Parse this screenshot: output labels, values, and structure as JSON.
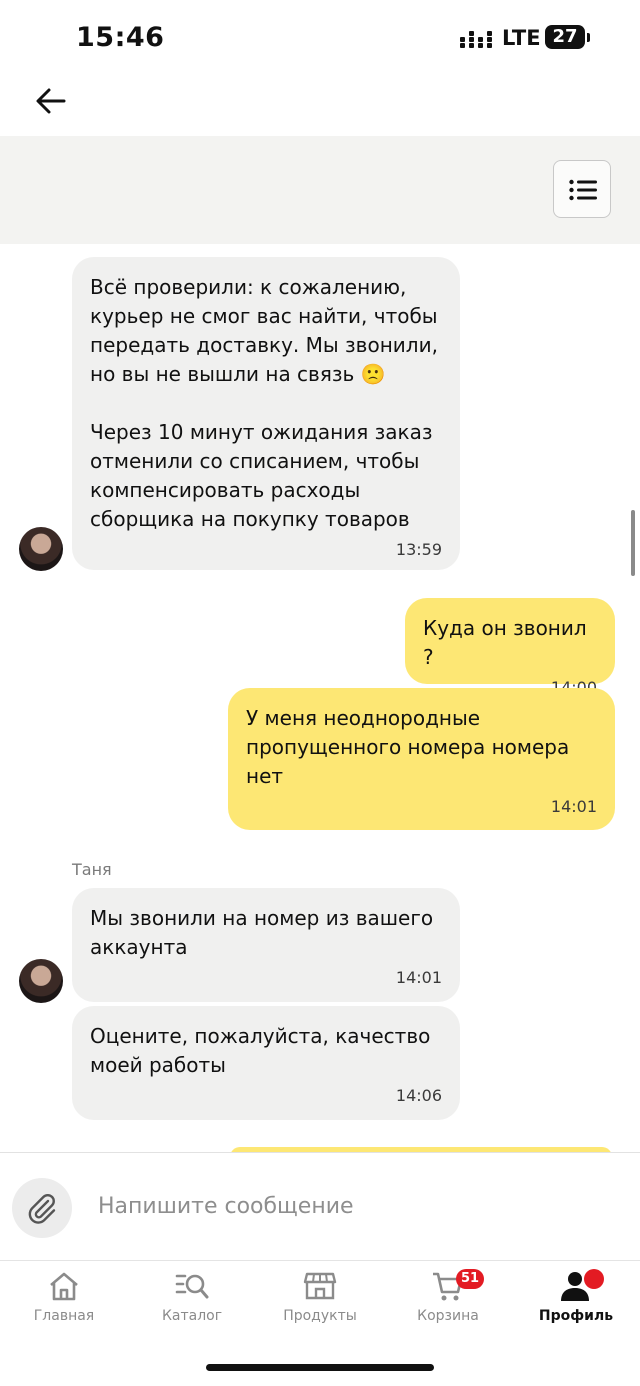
{
  "status_bar": {
    "time": "15:46",
    "network": "LTE",
    "battery": "27"
  },
  "colors": {
    "incoming_bubble": "#f0f0ef",
    "outgoing_bubble": "#fde774",
    "badge": "#e31b23"
  },
  "chat": {
    "messages": [
      {
        "sender": "Таня",
        "text": "Всё проверили: к сожалению,\nкурьер не смог вас найти, чтобы\nпередать доставку. Мы звонили,\nно вы не вышли на связь 🙁\n\nЧерез 10 минут ожидания заказ\nотменили со списанием, чтобы\nкомпенсировать расходы\nсборщика на покупку товаров",
        "time": "13:59"
      },
      {
        "text": "Куда он звонил ?",
        "time": "14:00"
      },
      {
        "text": "У меня неоднородные\nпропущенного номера номера\nнет",
        "time": "14:01"
      },
      {
        "sender": "Таня",
        "text": "Мы звонили на номер из вашего\nаккаунта",
        "time": "14:01"
      },
      {
        "text": "Оцените, пожалуйста, качество\nмоей работы",
        "time": "14:06"
      }
    ]
  },
  "input": {
    "placeholder": "Напишите сообщение"
  },
  "tabbar": {
    "items": [
      {
        "label": "Главная",
        "icon": "home-icon"
      },
      {
        "label": "Каталог",
        "icon": "catalog-search-icon"
      },
      {
        "label": "Продукты",
        "icon": "store-icon"
      },
      {
        "label": "Корзина",
        "icon": "cart-icon",
        "badge": "51"
      },
      {
        "label": "Профиль",
        "icon": "profile-icon",
        "active": true
      }
    ]
  }
}
